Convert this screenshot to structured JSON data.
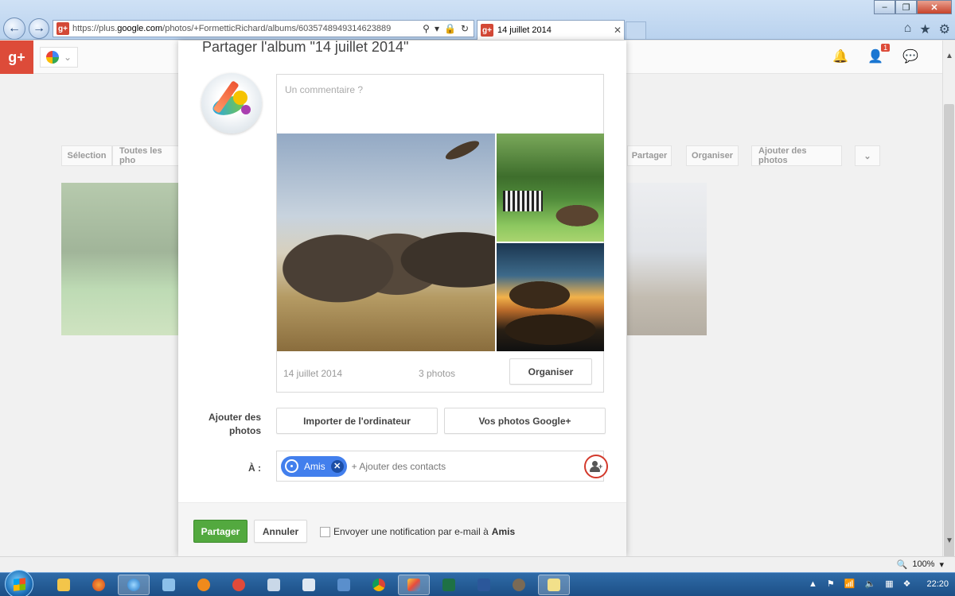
{
  "browser": {
    "url_prefix": "https://plus.",
    "url_domain": "google.com",
    "url_path": "/photos/+FormetticRichard/albums/6035748949314623889",
    "tab_title": "14 juillet 2014",
    "favicon_text": "g+"
  },
  "gbar": {
    "logo_text": "g+",
    "notification_count": "1"
  },
  "background": {
    "toolbar": {
      "selection": "Sélection",
      "all_photos": "Toutes les pho",
      "share": "Partager",
      "organize": "Organiser",
      "add_photos": "Ajouter des photos"
    }
  },
  "dialog": {
    "title": "Partager l'album \"14 juillet 2014\"",
    "comment_placeholder": "Un commentaire ?",
    "album": {
      "date": "14 juillet 2014",
      "count": "3 photos",
      "organize_button": "Organiser"
    },
    "add_photos": {
      "label_line1": "Ajouter des",
      "label_line2": "photos",
      "import_button": "Importer de l'ordinateur",
      "gplus_button": "Vos photos Google+"
    },
    "recipients": {
      "label": "À :",
      "chip_label": "Amis",
      "add_contacts_placeholder": "+ Ajouter des contacts"
    },
    "footer": {
      "share_button": "Partager",
      "cancel_button": "Annuler",
      "notify_text": "Envoyer une notification par e-mail à",
      "notify_target": "Amis"
    }
  },
  "statusbar": {
    "zoom": "100%"
  },
  "taskbar": {
    "time": "22:20"
  },
  "colors": {
    "gplus_red": "#dd4b39",
    "share_green": "#53a93f",
    "chip_blue": "#427fed",
    "highlight_circle": "#d33a2c"
  }
}
